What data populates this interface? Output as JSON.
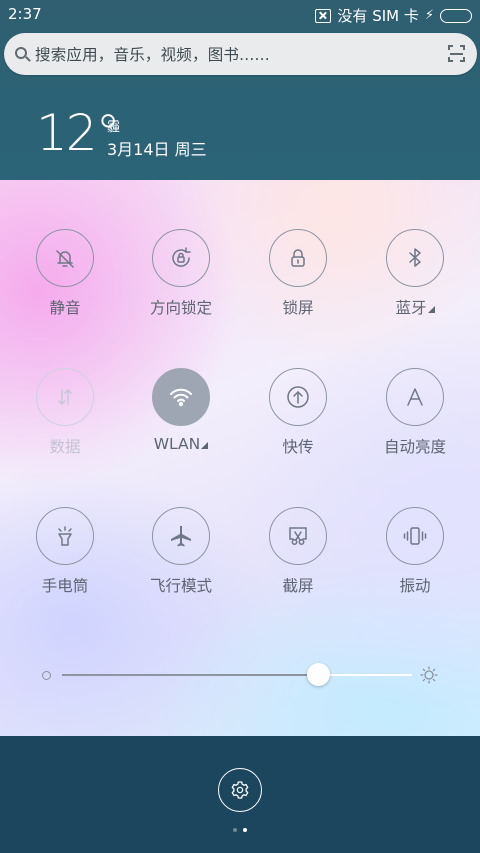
{
  "status_bar": {
    "time": "2:37",
    "sim_text": "没有 SIM 卡",
    "battery_level": 1.0,
    "battery_color": "#52d21a"
  },
  "search": {
    "placeholder": "搜索应用，音乐，视频，图书......",
    "icon": "search-icon",
    "scan_icon": "scan-icon"
  },
  "weather": {
    "temperature": "12°",
    "condition": "霾",
    "date": "3月14日 周三"
  },
  "toggles": [
    {
      "label": "静音",
      "icon": "bell-off-icon",
      "state": "off"
    },
    {
      "label": "方向锁定",
      "icon": "rotation-lock-icon",
      "state": "off"
    },
    {
      "label": "锁屏",
      "icon": "lock-icon",
      "state": "off"
    },
    {
      "label": "蓝牙",
      "icon": "bluetooth-icon",
      "state": "off",
      "has_submenu": true
    },
    {
      "label": "数据",
      "icon": "data-arrows-icon",
      "state": "disabled"
    },
    {
      "label": "WLAN",
      "icon": "wifi-icon",
      "state": "on",
      "has_submenu": true
    },
    {
      "label": "快传",
      "icon": "quick-send-icon",
      "state": "off"
    },
    {
      "label": "自动亮度",
      "icon": "auto-brightness-icon",
      "state": "off"
    },
    {
      "label": "手电筒",
      "icon": "flashlight-icon",
      "state": "off"
    },
    {
      "label": "飞行模式",
      "icon": "airplane-icon",
      "state": "off"
    },
    {
      "label": "截屏",
      "icon": "screenshot-icon",
      "state": "off"
    },
    {
      "label": "振动",
      "icon": "vibrate-icon",
      "state": "off"
    }
  ],
  "brightness": {
    "level": 0.73
  },
  "colors": {
    "active_toggle": "#9ea6b4",
    "icon_gray": "#6f7886",
    "bottom_bar": "#1c465e"
  },
  "pager": {
    "count": 2,
    "active_index": 1
  },
  "settings_button": {
    "icon": "gear-icon"
  }
}
